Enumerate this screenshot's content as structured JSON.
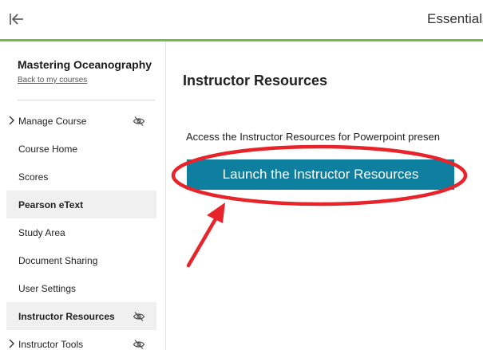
{
  "header": {
    "title": "Essentials",
    "collapse_icon": "collapse-sidebar-icon"
  },
  "sidebar": {
    "course_title": "Mastering Oceanography",
    "back_link": "Back to my courses",
    "items": [
      {
        "label": "Manage Course",
        "expandable": true,
        "hidden_icon": true,
        "active": false
      },
      {
        "label": "Course Home",
        "expandable": false,
        "hidden_icon": false,
        "active": false
      },
      {
        "label": "Scores",
        "expandable": false,
        "hidden_icon": false,
        "active": false
      },
      {
        "label": "Pearson eText",
        "expandable": false,
        "hidden_icon": false,
        "active": true
      },
      {
        "label": "Study Area",
        "expandable": false,
        "hidden_icon": false,
        "active": false
      },
      {
        "label": "Document Sharing",
        "expandable": false,
        "hidden_icon": false,
        "active": false
      },
      {
        "label": "User Settings",
        "expandable": false,
        "hidden_icon": false,
        "active": false
      },
      {
        "label": "Instructor Resources",
        "expandable": false,
        "hidden_icon": true,
        "active": true
      },
      {
        "label": "Instructor Tools",
        "expandable": true,
        "hidden_icon": true,
        "active": false
      }
    ]
  },
  "main": {
    "heading": "Instructor Resources",
    "description": "Access the Instructor Resources for Powerpoint presen",
    "launch_label": "Launch the Instructor Resources"
  },
  "colors": {
    "accent_line": "#6cbf3f",
    "button": "#0f7f9f",
    "annotation": "#e8242b"
  }
}
